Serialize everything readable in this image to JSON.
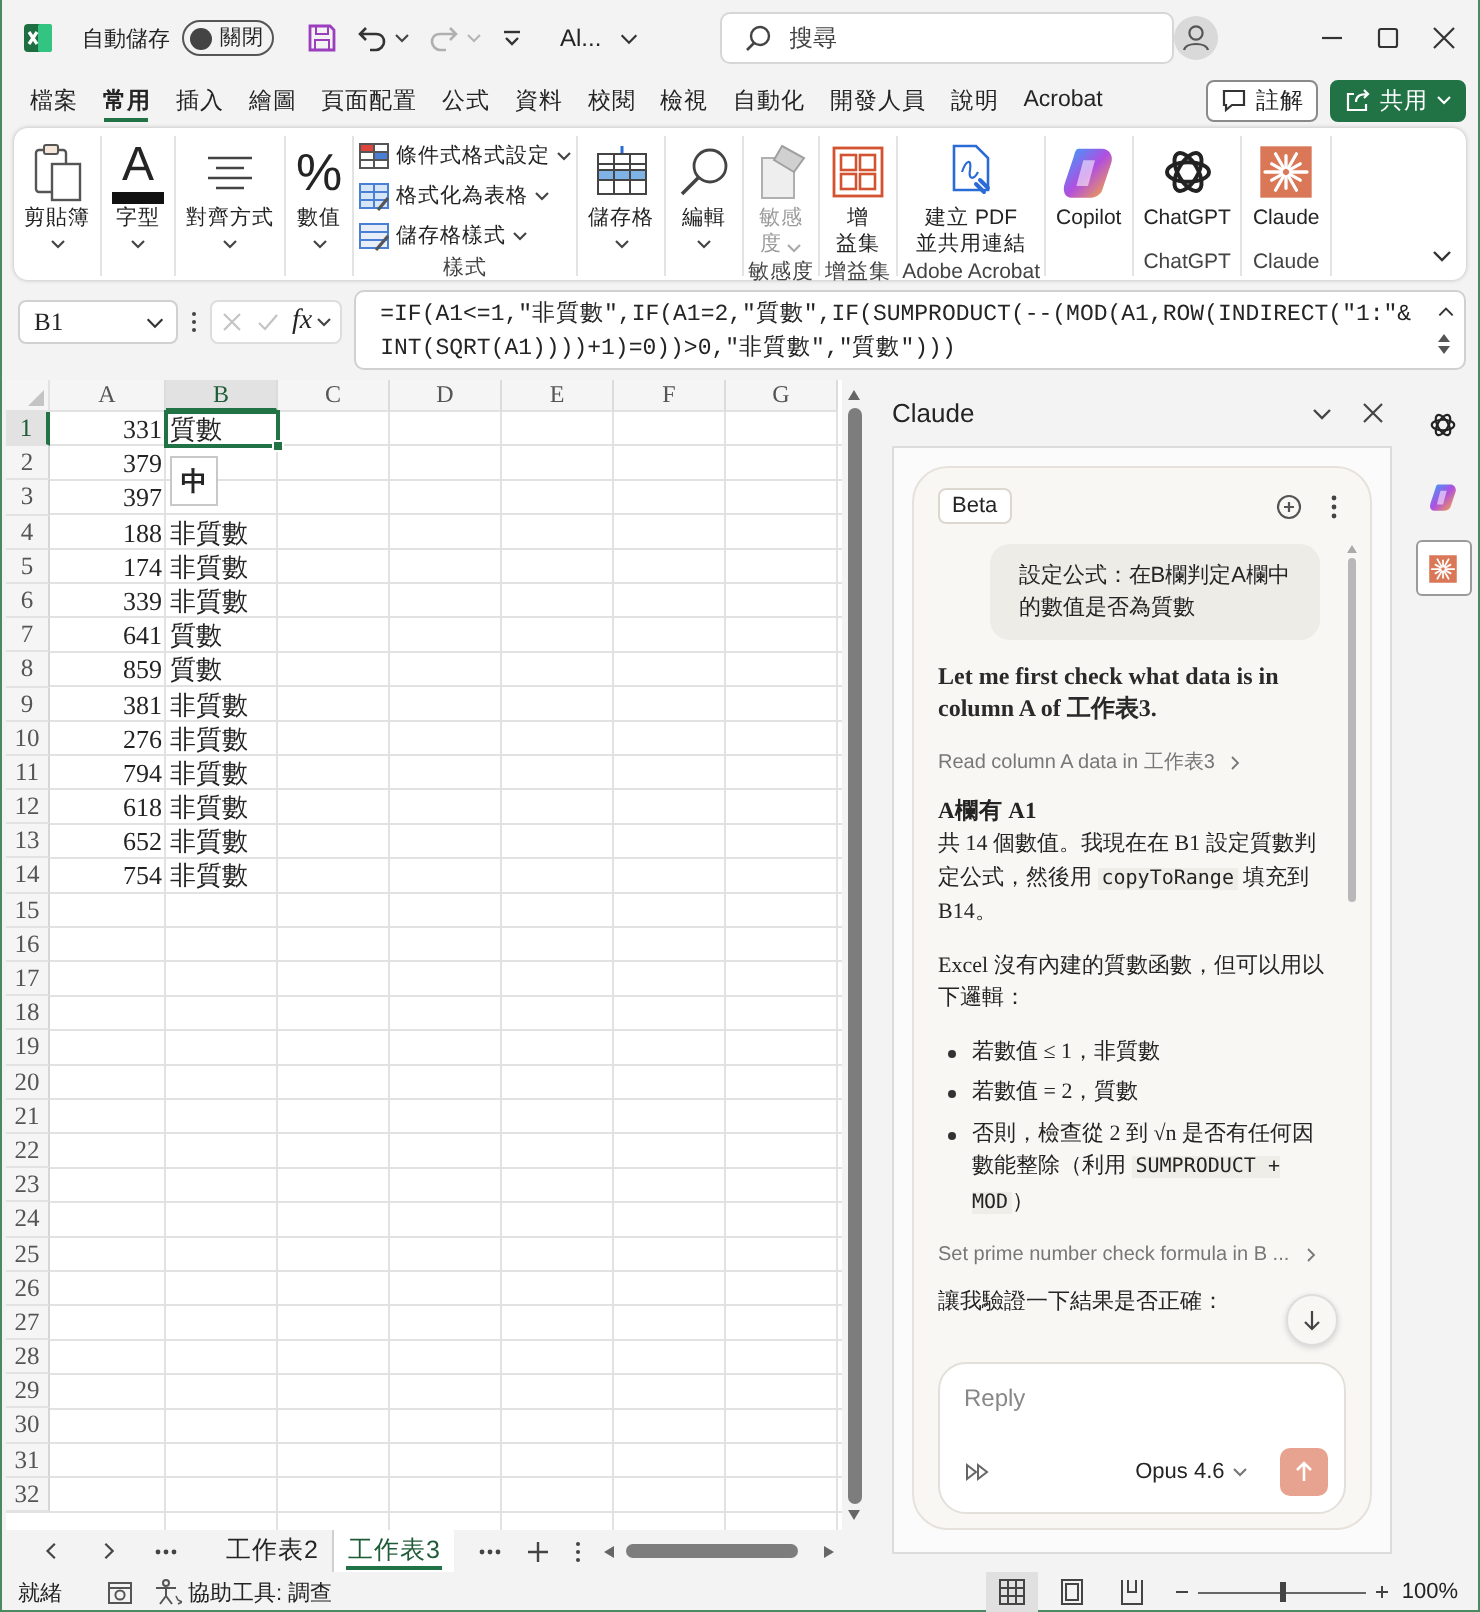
{
  "title_bar": {
    "autosave": {
      "label": "自動儲存",
      "toggle": {
        "label": "關閉",
        "on": false
      }
    },
    "undo": {
      "disabled": false
    },
    "redo": {
      "disabled": true
    },
    "file_name": "Al...",
    "search": {
      "placeholder": "搜尋"
    }
  },
  "menu_tabs": [
    {
      "label": "檔案",
      "selected": false
    },
    {
      "label": "常用",
      "selected": true
    },
    {
      "label": "插入",
      "selected": false
    },
    {
      "label": "繪圖",
      "selected": false
    },
    {
      "label": "頁面配置",
      "selected": false
    },
    {
      "label": "公式",
      "selected": false
    },
    {
      "label": "資料",
      "selected": false
    },
    {
      "label": "校閱",
      "selected": false
    },
    {
      "label": "檢視",
      "selected": false
    },
    {
      "label": "自動化",
      "selected": false
    },
    {
      "label": "開發人員",
      "selected": false
    },
    {
      "label": "說明",
      "selected": false
    },
    {
      "label": "Acrobat",
      "selected": false
    }
  ],
  "header_buttons": [
    {
      "kind": "comments",
      "label": "註解"
    },
    {
      "kind": "share",
      "label": "共用"
    }
  ],
  "ribbon": {
    "groups": [
      {
        "items": [
          {
            "kind": "clipboard",
            "lines": [
              "剪貼簿"
            ],
            "caret": true,
            "disabled": false
          }
        ]
      },
      {
        "items": [
          {
            "kind": "font",
            "glyph": "A",
            "lines": [
              "字型"
            ],
            "caret": true,
            "disabled": false
          }
        ]
      },
      {
        "items": [
          {
            "kind": "alignment",
            "lines": [
              "對齊方式"
            ],
            "caret": true,
            "disabled": false
          }
        ]
      },
      {
        "items": [
          {
            "kind": "number",
            "glyph": "%",
            "lines": [
              "數值"
            ],
            "caret": true,
            "disabled": false
          }
        ]
      },
      {
        "label": "樣式",
        "stack": [
          {
            "kind": "conditional",
            "label": "條件式格式設定"
          },
          {
            "kind": "table",
            "label": "格式化為表格"
          },
          {
            "kind": "cell_style",
            "label": "儲存格樣式"
          }
        ]
      },
      {
        "items": [
          {
            "kind": "cells",
            "lines": [
              "儲存格"
            ],
            "caret": true,
            "disabled": false
          }
        ]
      },
      {
        "items": [
          {
            "kind": "editing",
            "lines": [
              "編輯"
            ],
            "caret": true,
            "disabled": false
          }
        ]
      },
      {
        "label": "敏感度",
        "items": [
          {
            "kind": "sensitivity",
            "lines": [
              "敏感",
              "度"
            ],
            "caret": true,
            "disabled": true
          }
        ]
      },
      {
        "label": "增益集",
        "items": [
          {
            "kind": "add_ins",
            "lines": [
              "增",
              "益集"
            ],
            "caret": false,
            "disabled": false
          }
        ]
      },
      {
        "label": "Adobe Acrobat",
        "items": [
          {
            "kind": "pdf",
            "lines": [
              "建立 PDF",
              "並共用連結"
            ],
            "caret": false,
            "disabled": false
          }
        ]
      },
      {
        "items": [
          {
            "kind": "copilot",
            "lines": [
              "Copilot"
            ],
            "caret": false,
            "disabled": false
          }
        ]
      },
      {
        "label": "ChatGPT",
        "items": [
          {
            "kind": "chatgpt",
            "lines": [
              "ChatGPT"
            ],
            "caret": false,
            "disabled": false
          }
        ]
      },
      {
        "label": "Claude",
        "items": [
          {
            "kind": "claude",
            "lines": [
              "Claude"
            ],
            "caret": false,
            "disabled": false
          }
        ]
      }
    ]
  },
  "formula_bar": {
    "name_box": "B1",
    "function_label": "fx",
    "edit_disabled": true,
    "formula_lines": [
      "=IF(A1<=1,\"非質數\",IF(A1=2,\"質數\",IF(SUMPRODUCT(--(MOD(A1,ROW(INDIRECT(\"1:\"&",
      "INT(SQRT(A1))))+1)=0))>0,\"非質數\",\"質數\")))"
    ]
  },
  "sheet": {
    "columns": [
      {
        "label": "A",
        "selected": false
      },
      {
        "label": "B",
        "selected": true
      },
      {
        "label": "C",
        "selected": false
      },
      {
        "label": "D",
        "selected": false
      },
      {
        "label": "E",
        "selected": false
      },
      {
        "label": "F",
        "selected": false
      },
      {
        "label": "G",
        "selected": false
      }
    ],
    "rows": [
      {
        "header": "1",
        "selected": true,
        "cells": [
          {
            "text": "331",
            "selected": false
          },
          {
            "text": "質數",
            "selected": true
          }
        ]
      },
      {
        "header": "2",
        "selected": false,
        "cells": [
          {
            "text": "379",
            "selected": false
          }
        ]
      },
      {
        "header": "3",
        "selected": false,
        "cells": [
          {
            "text": "397",
            "selected": false
          }
        ]
      },
      {
        "header": "4",
        "selected": false,
        "cells": [
          {
            "text": "188",
            "selected": false
          },
          {
            "text": "非質數",
            "selected": false
          }
        ]
      },
      {
        "header": "5",
        "selected": false,
        "cells": [
          {
            "text": "174",
            "selected": false
          },
          {
            "text": "非質數",
            "selected": false
          }
        ]
      },
      {
        "header": "6",
        "selected": false,
        "cells": [
          {
            "text": "339",
            "selected": false
          },
          {
            "text": "非質數",
            "selected": false
          }
        ]
      },
      {
        "header": "7",
        "selected": false,
        "cells": [
          {
            "text": "641",
            "selected": false
          },
          {
            "text": "質數",
            "selected": false
          }
        ]
      },
      {
        "header": "8",
        "selected": false,
        "cells": [
          {
            "text": "859",
            "selected": false
          },
          {
            "text": "質數",
            "selected": false
          }
        ]
      },
      {
        "header": "9",
        "selected": false,
        "cells": [
          {
            "text": "381",
            "selected": false
          },
          {
            "text": "非質數",
            "selected": false
          }
        ]
      },
      {
        "header": "10",
        "selected": false,
        "cells": [
          {
            "text": "276",
            "selected": false
          },
          {
            "text": "非質數",
            "selected": false
          }
        ]
      },
      {
        "header": "11",
        "selected": false,
        "cells": [
          {
            "text": "794",
            "selected": false
          },
          {
            "text": "非質數",
            "selected": false
          }
        ]
      },
      {
        "header": "12",
        "selected": false,
        "cells": [
          {
            "text": "618",
            "selected": false
          },
          {
            "text": "非質數",
            "selected": false
          }
        ]
      },
      {
        "header": "13",
        "selected": false,
        "cells": [
          {
            "text": "652",
            "selected": false
          },
          {
            "text": "非質數",
            "selected": false
          }
        ]
      },
      {
        "header": "14",
        "selected": false,
        "cells": [
          {
            "text": "754",
            "selected": false
          },
          {
            "text": "非質數",
            "selected": false
          }
        ]
      },
      {
        "header": "15",
        "selected": false
      },
      {
        "header": "16",
        "selected": false
      },
      {
        "header": "17",
        "selected": false
      },
      {
        "header": "18",
        "selected": false
      },
      {
        "header": "19",
        "selected": false
      },
      {
        "header": "20",
        "selected": false
      },
      {
        "header": "21",
        "selected": false
      },
      {
        "header": "22",
        "selected": false
      },
      {
        "header": "23",
        "selected": false
      },
      {
        "header": "24",
        "selected": false
      },
      {
        "header": "25",
        "selected": false
      },
      {
        "header": "26",
        "selected": false
      },
      {
        "header": "27",
        "selected": false
      },
      {
        "header": "28",
        "selected": false
      },
      {
        "header": "29",
        "selected": false
      },
      {
        "header": "30",
        "selected": false
      },
      {
        "header": "31",
        "selected": false
      },
      {
        "header": "32",
        "selected": false
      }
    ],
    "ime_indicator": "中"
  },
  "sheet_tabs": [
    {
      "label": "工作表2",
      "selected": false
    },
    {
      "label": "工作表3",
      "selected": true
    }
  ],
  "assistant": {
    "title": "Claude",
    "badge": "Beta",
    "messages": [
      {
        "kind": "user",
        "text": "設定公式：在B欄判定A欄中的數值是否為質數"
      },
      {
        "kind": "lead",
        "text": "Let me first check what data is in column A of 工作表3."
      },
      {
        "kind": "tool",
        "text": "Read column A data in 工作表3"
      },
      {
        "kind": "strong",
        "text": "A欄有 A1"
      },
      {
        "kind": "para",
        "runs": [
          {
            "kind": "text",
            "text": "共 14 個數值。我現在在 B1 設定質數判定公式，然後用 "
          },
          {
            "kind": "code",
            "text": "copyToRange"
          },
          {
            "kind": "text",
            "text": " 填充到 B14。"
          }
        ]
      },
      {
        "kind": "para",
        "runs": [
          {
            "kind": "text",
            "text": "Excel 沒有內建的質數函數，但可以用以下邏輯："
          }
        ]
      },
      {
        "kind": "list",
        "items": [
          {
            "runs": [
              {
                "kind": "text",
                "text": "若數值 ≤ 1，非質數"
              }
            ]
          },
          {
            "runs": [
              {
                "kind": "text",
                "text": "若數值 = 2，質數"
              }
            ]
          },
          {
            "runs": [
              {
                "kind": "text",
                "text": "否則，檢查從 2 到 √n 是否有任何因數能整除（利用 "
              },
              {
                "kind": "code",
                "text": "SUMPRODUCT + MOD"
              },
              {
                "kind": "text",
                "text": "）"
              }
            ]
          }
        ]
      },
      {
        "kind": "tool",
        "text": "Set prime number check formula in B ..."
      },
      {
        "kind": "para",
        "runs": [
          {
            "kind": "text",
            "text": "讓我驗證一下結果是否正確："
          }
        ]
      }
    ],
    "composer": {
      "placeholder": "Reply",
      "model": "Opus 4.6"
    }
  },
  "side_apps": [
    {
      "kind": "chatgpt",
      "selected": false
    },
    {
      "kind": "copilot",
      "selected": false
    },
    {
      "kind": "claude",
      "selected": true
    }
  ],
  "status_bar": {
    "status": "就緒",
    "accessibility": "協助工具: 調查",
    "views": [
      {
        "kind": "normal",
        "selected": true
      },
      {
        "kind": "page_layout",
        "selected": false
      },
      {
        "kind": "page_break",
        "selected": false
      }
    ],
    "zoom": {
      "level": 0.5,
      "label": "100%"
    }
  }
}
